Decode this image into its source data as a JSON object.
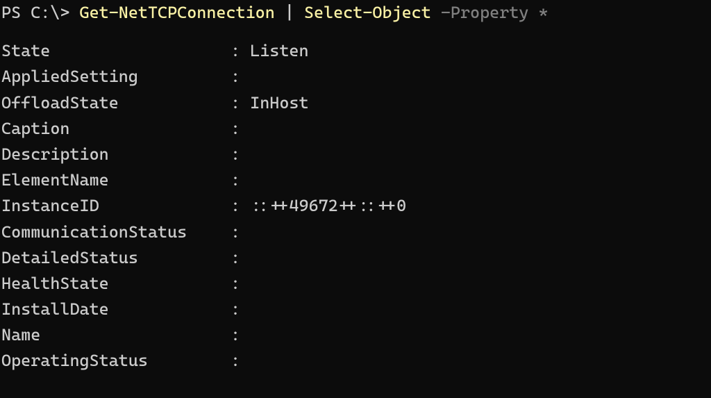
{
  "prompt": {
    "prefix": "PS C:\\> ",
    "cmdlet1": "Get-NetTCPConnection",
    "pipe": " | ",
    "cmdlet2": "Select-Object",
    "param_name": " -Property ",
    "param_value": "*"
  },
  "output": [
    {
      "key": "State",
      "value": "Listen"
    },
    {
      "key": "AppliedSetting",
      "value": ""
    },
    {
      "key": "OffloadState",
      "value": "InHost"
    },
    {
      "key": "Caption",
      "value": ""
    },
    {
      "key": "Description",
      "value": ""
    },
    {
      "key": "ElementName",
      "value": ""
    },
    {
      "key": "InstanceID",
      "value": "::++49672++::++0"
    },
    {
      "key": "CommunicationStatus",
      "value": ""
    },
    {
      "key": "DetailedStatus",
      "value": ""
    },
    {
      "key": "HealthState",
      "value": ""
    },
    {
      "key": "InstallDate",
      "value": ""
    },
    {
      "key": "Name",
      "value": ""
    },
    {
      "key": "OperatingStatus",
      "value": ""
    }
  ]
}
